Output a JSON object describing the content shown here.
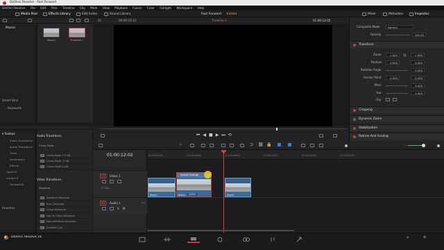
{
  "window": {
    "title": "DaVinci Resolve - Fast Forward"
  },
  "menu": [
    "DaVinci Resolve",
    "File",
    "Edit",
    "Trim",
    "Timeline",
    "Clip",
    "Mark",
    "View",
    "Playback",
    "Fusion",
    "Color",
    "Fairlight",
    "Workspace",
    "Help"
  ],
  "toolbar": {
    "media_pool": "Media Pool",
    "effects_library": "Effects Library",
    "edit_index": "Edit Index",
    "sound_library": "Sound Library",
    "project_title": "Fast Forward",
    "project_status": "Edited",
    "mixer": "Mixer",
    "metadata": "Metadata",
    "inspector": "Inspector"
  },
  "media_pool": {
    "bin": "Master",
    "smart_bins": "Smart Bins",
    "keywords": "Keywords",
    "clips": [
      {
        "name": "Beach"
      },
      {
        "name": "Timeline 1"
      }
    ]
  },
  "viewer": {
    "zoom": "Fit",
    "source_timecode": "00:00:15:12",
    "timeline_name": "Timeline 1",
    "timecode": "01:00:12:02"
  },
  "inspector": {
    "composite_mode_label": "Composite Mode",
    "composite_mode_value": "Normal",
    "opacity_label": "Opacity",
    "opacity_value": "100.00",
    "transform": "Transform",
    "zoom_label": "Zoom",
    "zoom_x": "1.000",
    "zoom_y": "1.000",
    "position_label": "Position",
    "position_x": "0.000",
    "position_y": "0.000",
    "rotation_label": "Rotation Angle",
    "rotation_value": "0.000",
    "anchor_label": "Anchor Point",
    "anchor_x": "0.000",
    "anchor_y": "0.000",
    "pitch_label": "Pitch",
    "pitch_value": "0.000",
    "yaw_label": "Yaw",
    "yaw_value": "0.000",
    "flip_label": "Flip",
    "cropping": "Cropping",
    "dynamic_zoom": "Dynamic Zoom",
    "stabilization": "Stabilization",
    "retime": "Retime And Scaling"
  },
  "effects": {
    "toolbox": "Toolbox",
    "categories": [
      "Video Transitions",
      "Audio Transitions",
      "Titles",
      "Generators",
      "Effects",
      "OpenFX",
      "Audio FX",
      "FairlightFX"
    ],
    "favorites": "Favorites",
    "audio_transitions_header": "Audio Transitions",
    "cross_fade_group": "Cross Fade",
    "audio_items": [
      "Cross Fade +3 dB",
      "Cross Fade -3 dB",
      "Cross Fade 0 dB"
    ],
    "video_transitions_header": "Video Transitions",
    "dissolve_group": "Dissolve",
    "video_items": [
      "Additive Dissolve",
      "Blur Dissolve",
      "Cross Dissolve",
      "Dip To Color Dissolve",
      "Non-Additive Dissolve",
      "Smooth Cut"
    ]
  },
  "timeline": {
    "timecode": "01:00:12:02",
    "ruler_ticks": [
      "01:00:00:00",
      "01:00:04:00",
      "01:00:08:00",
      "01:00:12:00",
      "01:00:16:00",
      "01:00:20:00"
    ],
    "video_track_id": "V1",
    "video_track_name": "Video 1",
    "video_track_clips": "2 Clips",
    "audio_track_id": "A1",
    "audio_track_name": "Audio 1",
    "audio_track_channel": "2.0",
    "clips": [
      {
        "name": "Beach"
      },
      {
        "name": "Beach",
        "badge": "Speed Change",
        "speed": "120%"
      },
      {
        "name": "Beach"
      }
    ]
  },
  "footer": {
    "app_name": "DaVinci Resolve 16"
  },
  "colors": {
    "accent": "#d23a3a",
    "clip_blue": "#3a6a9a",
    "playhead": "#e63a3a"
  }
}
